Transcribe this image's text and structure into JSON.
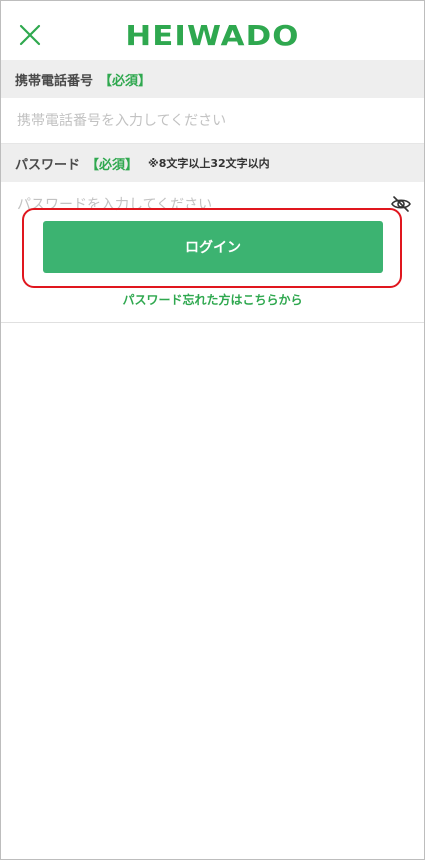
{
  "header": {
    "logo_text": "HEIWADO",
    "close_icon": "close-icon"
  },
  "phone": {
    "label": "携帯電話番号",
    "required": "【必須】",
    "placeholder": "携帯電話番号を入力してください",
    "value": ""
  },
  "password": {
    "label": "パスワード",
    "required": "【必須】",
    "note": "※8文字以上32文字以内",
    "placeholder": "パスワードを入力してください",
    "value": "",
    "toggle_icon": "eye-slash-icon"
  },
  "actions": {
    "login_label": "ログイン",
    "forgot_label": "パスワード忘れた方はこちらから"
  },
  "colors": {
    "brand_green": "#2fa84f",
    "button_green": "#3cb371",
    "highlight_red": "#e0161e",
    "label_background": "#eeeeee"
  }
}
